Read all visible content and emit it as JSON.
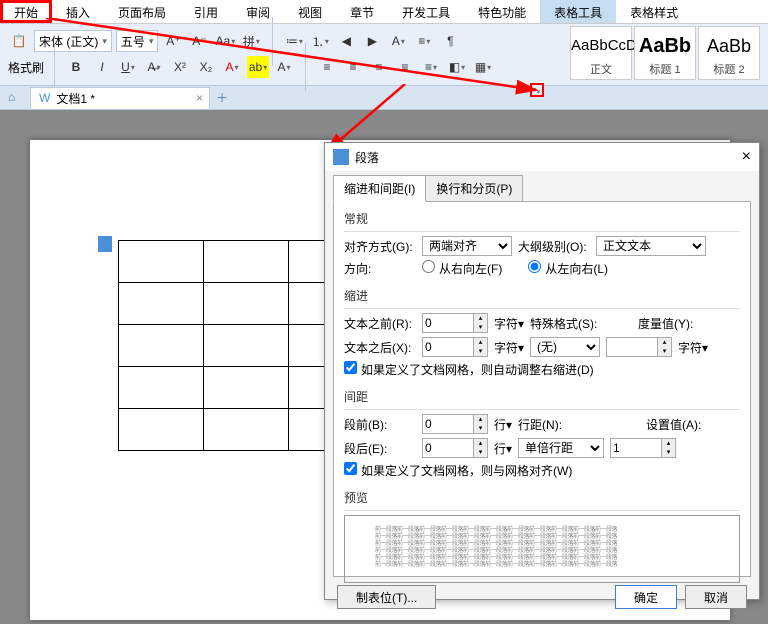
{
  "menu": {
    "items": [
      "开始",
      "插入",
      "页面布局",
      "引用",
      "审阅",
      "视图",
      "章节",
      "开发工具",
      "特色功能",
      "表格工具",
      "表格样式"
    ]
  },
  "ribbon": {
    "format_painter": "格式刷",
    "font_name": "宋体 (正文)",
    "font_size": "五号",
    "styles": [
      {
        "preview": "AaBbCcDd",
        "label": "正文"
      },
      {
        "preview": "AaBb",
        "label": "标题 1"
      },
      {
        "preview": "AaBb",
        "label": "标题 2"
      }
    ]
  },
  "doc_tab": {
    "title": "文档1 *"
  },
  "dialog": {
    "title": "段落",
    "tabs": {
      "t1": "缩进和间距(I)",
      "t2": "换行和分页(P)"
    },
    "general": {
      "legend": "常规",
      "align_lbl": "对齐方式(G):",
      "align_val": "两端对齐",
      "outline_lbl": "大纲级别(O):",
      "outline_val": "正文文本",
      "dir_lbl": "方向:",
      "dir_rtl": "从右向左(F)",
      "dir_ltr": "从左向右(L)"
    },
    "indent": {
      "legend": "缩进",
      "before_lbl": "文本之前(R):",
      "before_val": "0",
      "unit1": "字符▾",
      "after_lbl": "文本之后(X):",
      "after_val": "0",
      "unit2": "字符▾",
      "special_lbl": "特殊格式(S):",
      "special_val": "(无)",
      "measure_lbl": "度量值(Y):",
      "measure_unit": "字符▾",
      "chk": "如果定义了文档网格，则自动调整右缩进(D)"
    },
    "spacing": {
      "legend": "间距",
      "before_lbl": "段前(B):",
      "before_val": "0",
      "unit": "行▾",
      "after_lbl": "段后(E):",
      "after_val": "0",
      "line_lbl": "行距(N):",
      "line_val": "单倍行距",
      "set_lbl": "设置值(A):",
      "set_val": "1",
      "chk": "如果定义了文档网格，则与网格对齐(W)"
    },
    "preview": {
      "legend": "预览",
      "text": "前一段落前一段落前一段落前一段落前一段落前一段落前一段落前一段落前一段落前一段落前一段落"
    },
    "foot": {
      "tabs": "制表位(T)...",
      "ok": "确定",
      "cancel": "取消"
    }
  }
}
